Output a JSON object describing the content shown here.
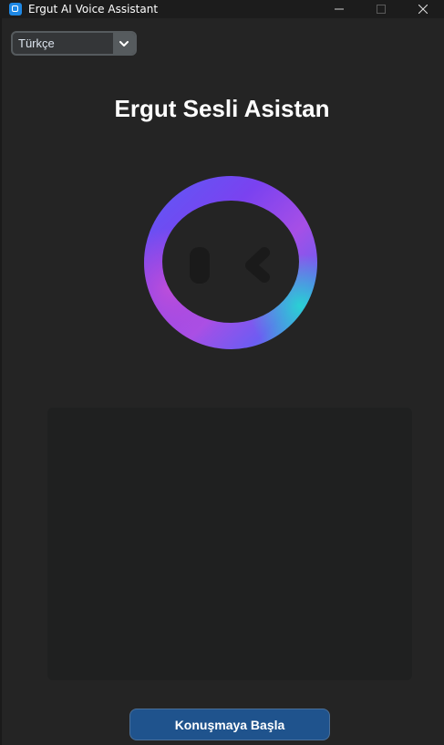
{
  "window": {
    "title": "Ergut AI Voice Assistant",
    "icon": "app-window-icon"
  },
  "language_select": {
    "value": "Türkçe",
    "icon": "chevron-down-icon"
  },
  "page_title": "Ergut Sesli Asistan",
  "avatar": {
    "icon": "robot-face-ring-icon",
    "colors": [
      "#6a3ff5",
      "#b24fe0",
      "#2ab7d9"
    ]
  },
  "transcript": {
    "text": ""
  },
  "start_button": {
    "label": "Konuşmaya Başla",
    "color": "#1f538d"
  }
}
